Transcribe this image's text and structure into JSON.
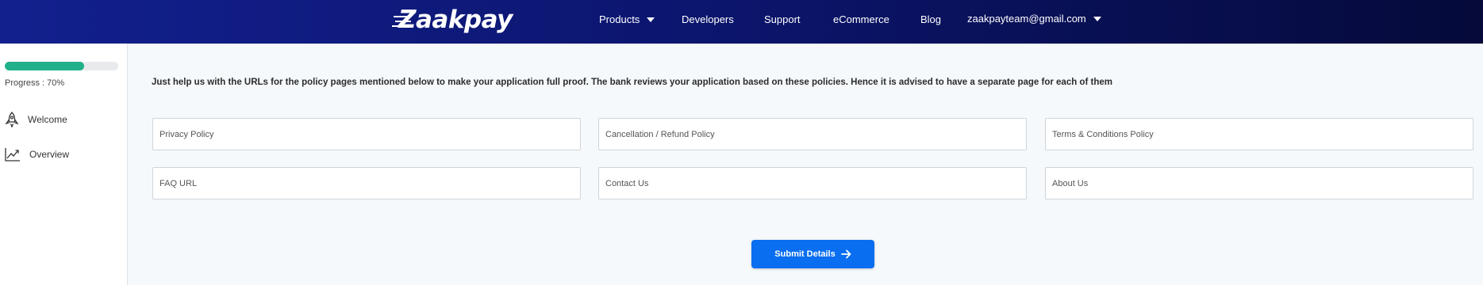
{
  "brand": {
    "name": "Zaakpay"
  },
  "nav": {
    "products": "Products",
    "developers": "Developers",
    "support": "Support",
    "ecommerce": "eCommerce",
    "blog": "Blog",
    "account": "zaakpayteam@gmail.com"
  },
  "sidebar": {
    "progress_label": "Progress : 70%",
    "progress_value": 0.7,
    "items": [
      {
        "label": "Welcome",
        "icon": "rocket-icon"
      },
      {
        "label": "Overview",
        "icon": "trend-chart-icon"
      }
    ]
  },
  "main": {
    "intro": "Just help us with the URLs for the policy pages mentioned below to make your application full proof. The bank reviews your application based on these policies. Hence it is advised to have a separate page for each of them",
    "fields": [
      {
        "placeholder": "Privacy Policy",
        "value": ""
      },
      {
        "placeholder": "Cancellation / Refund Policy",
        "value": ""
      },
      {
        "placeholder": "Terms & Conditions Policy",
        "value": ""
      },
      {
        "placeholder": "FAQ URL",
        "value": ""
      },
      {
        "placeholder": "Contact Us",
        "value": ""
      },
      {
        "placeholder": "About Us",
        "value": ""
      }
    ],
    "submit_label": "Submit Details"
  },
  "colors": {
    "nav_start": "#12208e",
    "nav_end": "#050a3a",
    "progress": "#20b08a",
    "primary_button": "#0a6ef0"
  }
}
